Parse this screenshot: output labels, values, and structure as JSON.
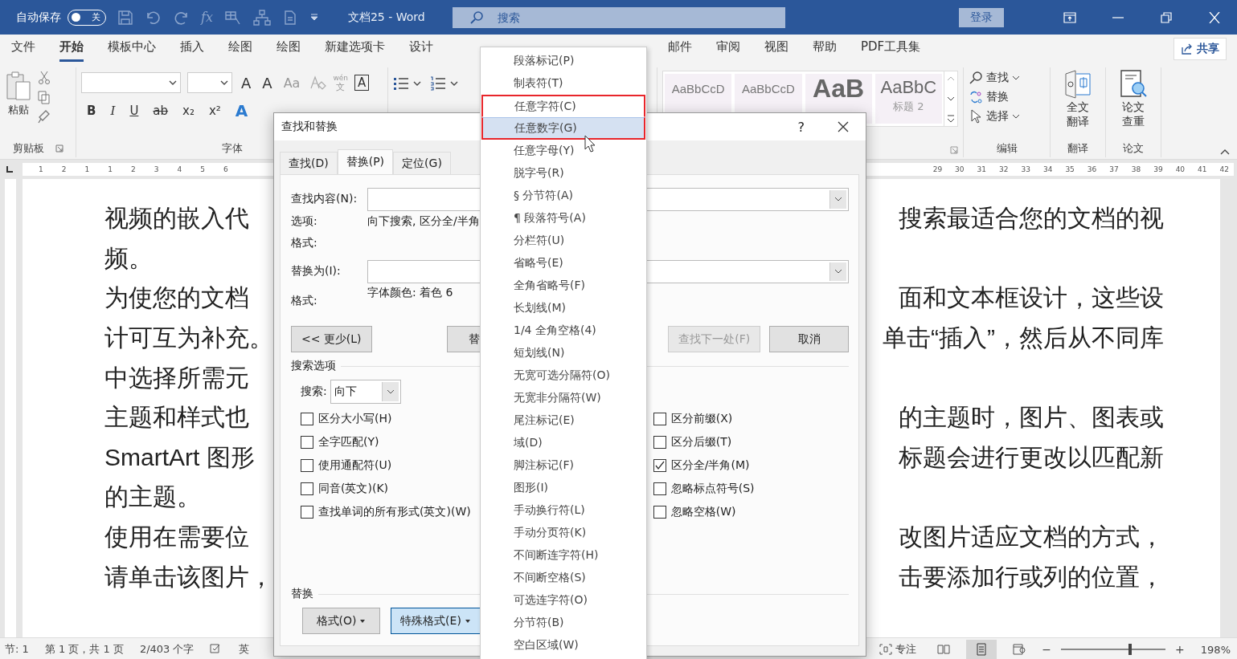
{
  "title_bar": {
    "autosave_label": "自动保存",
    "autosave": {
      "on": false,
      "label": "关"
    },
    "formula": "fx",
    "doc_title": "文档25  -  Word",
    "search_placeholder": "搜索",
    "sign_in": "登录"
  },
  "ribbon_tabs": [
    {
      "label": "文件",
      "selected": false
    },
    {
      "label": "开始",
      "selected": true
    },
    {
      "label": "模板中心",
      "selected": false
    },
    {
      "label": "插入",
      "selected": false
    },
    {
      "label": "绘图",
      "selected": false
    },
    {
      "label": "绘图",
      "selected": false
    },
    {
      "label": "新建选项卡",
      "selected": false
    },
    {
      "label": "设计",
      "selected": false
    },
    {
      "label": "邮件",
      "selected": false
    },
    {
      "label": "审阅",
      "selected": false
    },
    {
      "label": "视图",
      "selected": false
    },
    {
      "label": "帮助",
      "selected": false
    },
    {
      "label": "PDF工具集",
      "selected": false
    }
  ],
  "share": "共享",
  "ribbon": {
    "clipboard": {
      "paste": "粘贴",
      "group": "剪贴板"
    },
    "font": {
      "row1": [
        "A",
        "A",
        "Aa"
      ],
      "phonetic": "wén",
      "phonetic_char": "文",
      "boxed": "A",
      "row2": [
        "B",
        "I",
        "U",
        "ab",
        "x₂",
        "x²"
      ],
      "effects": "A",
      "group": "字体"
    },
    "styles": [
      {
        "sample": "AaBbCcD",
        "kind": "body"
      },
      {
        "sample": "AaBbCcD",
        "kind": "body"
      },
      {
        "sample": "AaB",
        "kind": "heading1"
      },
      {
        "sample": "AaBbC",
        "kind": "heading2",
        "name": "标题 2"
      }
    ],
    "editing": {
      "find": "查找",
      "replace": "替换",
      "select": "选择",
      "group": "编辑"
    },
    "translate": {
      "label": "全文翻译",
      "group": "翻译"
    },
    "paper": {
      "label": "论文查重",
      "group": "论文"
    }
  },
  "ruler": {
    "left_numbers": [
      "1",
      "2",
      "1",
      "1",
      "2",
      "3",
      "4",
      "5",
      "6"
    ],
    "right_numbers": [
      "29",
      "30",
      "31",
      "32",
      "33",
      "34",
      "35",
      "36",
      "37",
      "38",
      "39",
      "40",
      "41",
      "42"
    ]
  },
  "document": {
    "lines": [
      {
        "left": "视频的嵌入代",
        "right": "搜索最适合您的文档的视"
      },
      {
        "left": "频。"
      },
      {
        "left": "为使您的文档",
        "right": "面和文本框设计，这些设"
      },
      {
        "left": "计可互为补充。",
        "right": "单击“插入”，然后从不同库"
      },
      {
        "left": "中选择所需元"
      },
      {
        "left": "主题和样式也",
        "right": "的主题时，图片、图表或"
      },
      {
        "left": "SmartArt 图形",
        "right": "标题会进行更改以匹配新"
      },
      {
        "left": "的主题。"
      },
      {
        "left": "使用在需要位",
        "right": "改图片适应文档的方式，"
      },
      {
        "left": "请单击该图片，",
        "right": "击要添加行或列的位置，"
      }
    ]
  },
  "dialog": {
    "title": "查找和替换",
    "help": "?",
    "tabs": [
      {
        "label": "查找(D)",
        "selected": false
      },
      {
        "label": "替换(P)",
        "selected": true
      },
      {
        "label": "定位(G)",
        "selected": false
      }
    ],
    "find_label": "查找内容(N):",
    "options_label": "选项:",
    "options_value": "向下搜索, 区分全/半角",
    "format_label": "格式:",
    "replace_label": "替换为(I):",
    "replace_format_label": "格式:",
    "replace_format_value": "字体颜色: 着色 6",
    "buttons": [
      {
        "label": "<< 更少(L)",
        "disabled": false
      },
      {
        "label": "替",
        "disabled": false
      },
      {
        "label": "查找下一处(F)",
        "disabled": true
      },
      {
        "label": "取消",
        "disabled": false
      }
    ],
    "search_options_title": "搜索选项",
    "direction_label": "搜索:",
    "direction_value": "向下",
    "left_checks": [
      {
        "label": "区分大小写(H)",
        "checked": false
      },
      {
        "label": "全字匹配(Y)",
        "checked": false
      },
      {
        "label": "使用通配符(U)",
        "checked": false
      },
      {
        "label": "同音(英文)(K)",
        "checked": false
      },
      {
        "label": "查找单词的所有形式(英文)(W)",
        "checked": false
      }
    ],
    "right_checks": [
      {
        "label": "区分前缀(X)",
        "checked": false
      },
      {
        "label": "区分后缀(T)",
        "checked": false
      },
      {
        "label": "区分全/半角(M)",
        "checked": true
      },
      {
        "label": "忽略标点符号(S)",
        "checked": false
      },
      {
        "label": "忽略空格(W)",
        "checked": false
      }
    ],
    "replace_section": "替换",
    "bottom_buttons": [
      {
        "label": "格式(O)",
        "pressed": false
      },
      {
        "label": "特殊格式(E)",
        "pressed": true
      }
    ]
  },
  "special_menu": {
    "items": [
      {
        "label": "段落标记(P)",
        "selected": false,
        "framed": false
      },
      {
        "label": "制表符(T)",
        "selected": false,
        "framed": false
      },
      {
        "label": "任意字符(C)",
        "selected": false,
        "framed": true
      },
      {
        "label": "任意数字(G)",
        "selected": true,
        "framed": true
      },
      {
        "label": "任意字母(Y)",
        "selected": false,
        "framed": false
      },
      {
        "label": "脱字号(R)",
        "selected": false,
        "framed": false
      },
      {
        "label": "§ 分节符(A)",
        "selected": false,
        "framed": false
      },
      {
        "label": "¶ 段落符号(A)",
        "selected": false,
        "framed": false
      },
      {
        "label": "分栏符(U)",
        "selected": false,
        "framed": false
      },
      {
        "label": "省略号(E)",
        "selected": false,
        "framed": false
      },
      {
        "label": "全角省略号(F)",
        "selected": false,
        "framed": false
      },
      {
        "label": "长划线(M)",
        "selected": false,
        "framed": false
      },
      {
        "label": "1/4 全角空格(4)",
        "selected": false,
        "framed": false
      },
      {
        "label": "短划线(N)",
        "selected": false,
        "framed": false
      },
      {
        "label": "无宽可选分隔符(O)",
        "selected": false,
        "framed": false
      },
      {
        "label": "无宽非分隔符(W)",
        "selected": false,
        "framed": false
      },
      {
        "label": "尾注标记(E)",
        "selected": false,
        "framed": false
      },
      {
        "label": "域(D)",
        "selected": false,
        "framed": false
      },
      {
        "label": "脚注标记(F)",
        "selected": false,
        "framed": false
      },
      {
        "label": "图形(I)",
        "selected": false,
        "framed": false
      },
      {
        "label": "手动换行符(L)",
        "selected": false,
        "framed": false
      },
      {
        "label": "手动分页符(K)",
        "selected": false,
        "framed": false
      },
      {
        "label": "不间断连字符(H)",
        "selected": false,
        "framed": false
      },
      {
        "label": "不间断空格(S)",
        "selected": false,
        "framed": false
      },
      {
        "label": "可选连字符(O)",
        "selected": false,
        "framed": false
      },
      {
        "label": "分节符(B)",
        "selected": false,
        "framed": false
      },
      {
        "label": "空白区域(W)",
        "selected": false,
        "framed": false
      }
    ]
  },
  "status_bar": {
    "section": "节: 1",
    "page": "第 1 页，共 1 页",
    "words": "2/403 个字",
    "language": "英",
    "focus": "专注",
    "zoom_out": "−",
    "zoom_slider": {
      "level": 0.66
    },
    "zoom_in": "+",
    "zoom": "198%"
  }
}
